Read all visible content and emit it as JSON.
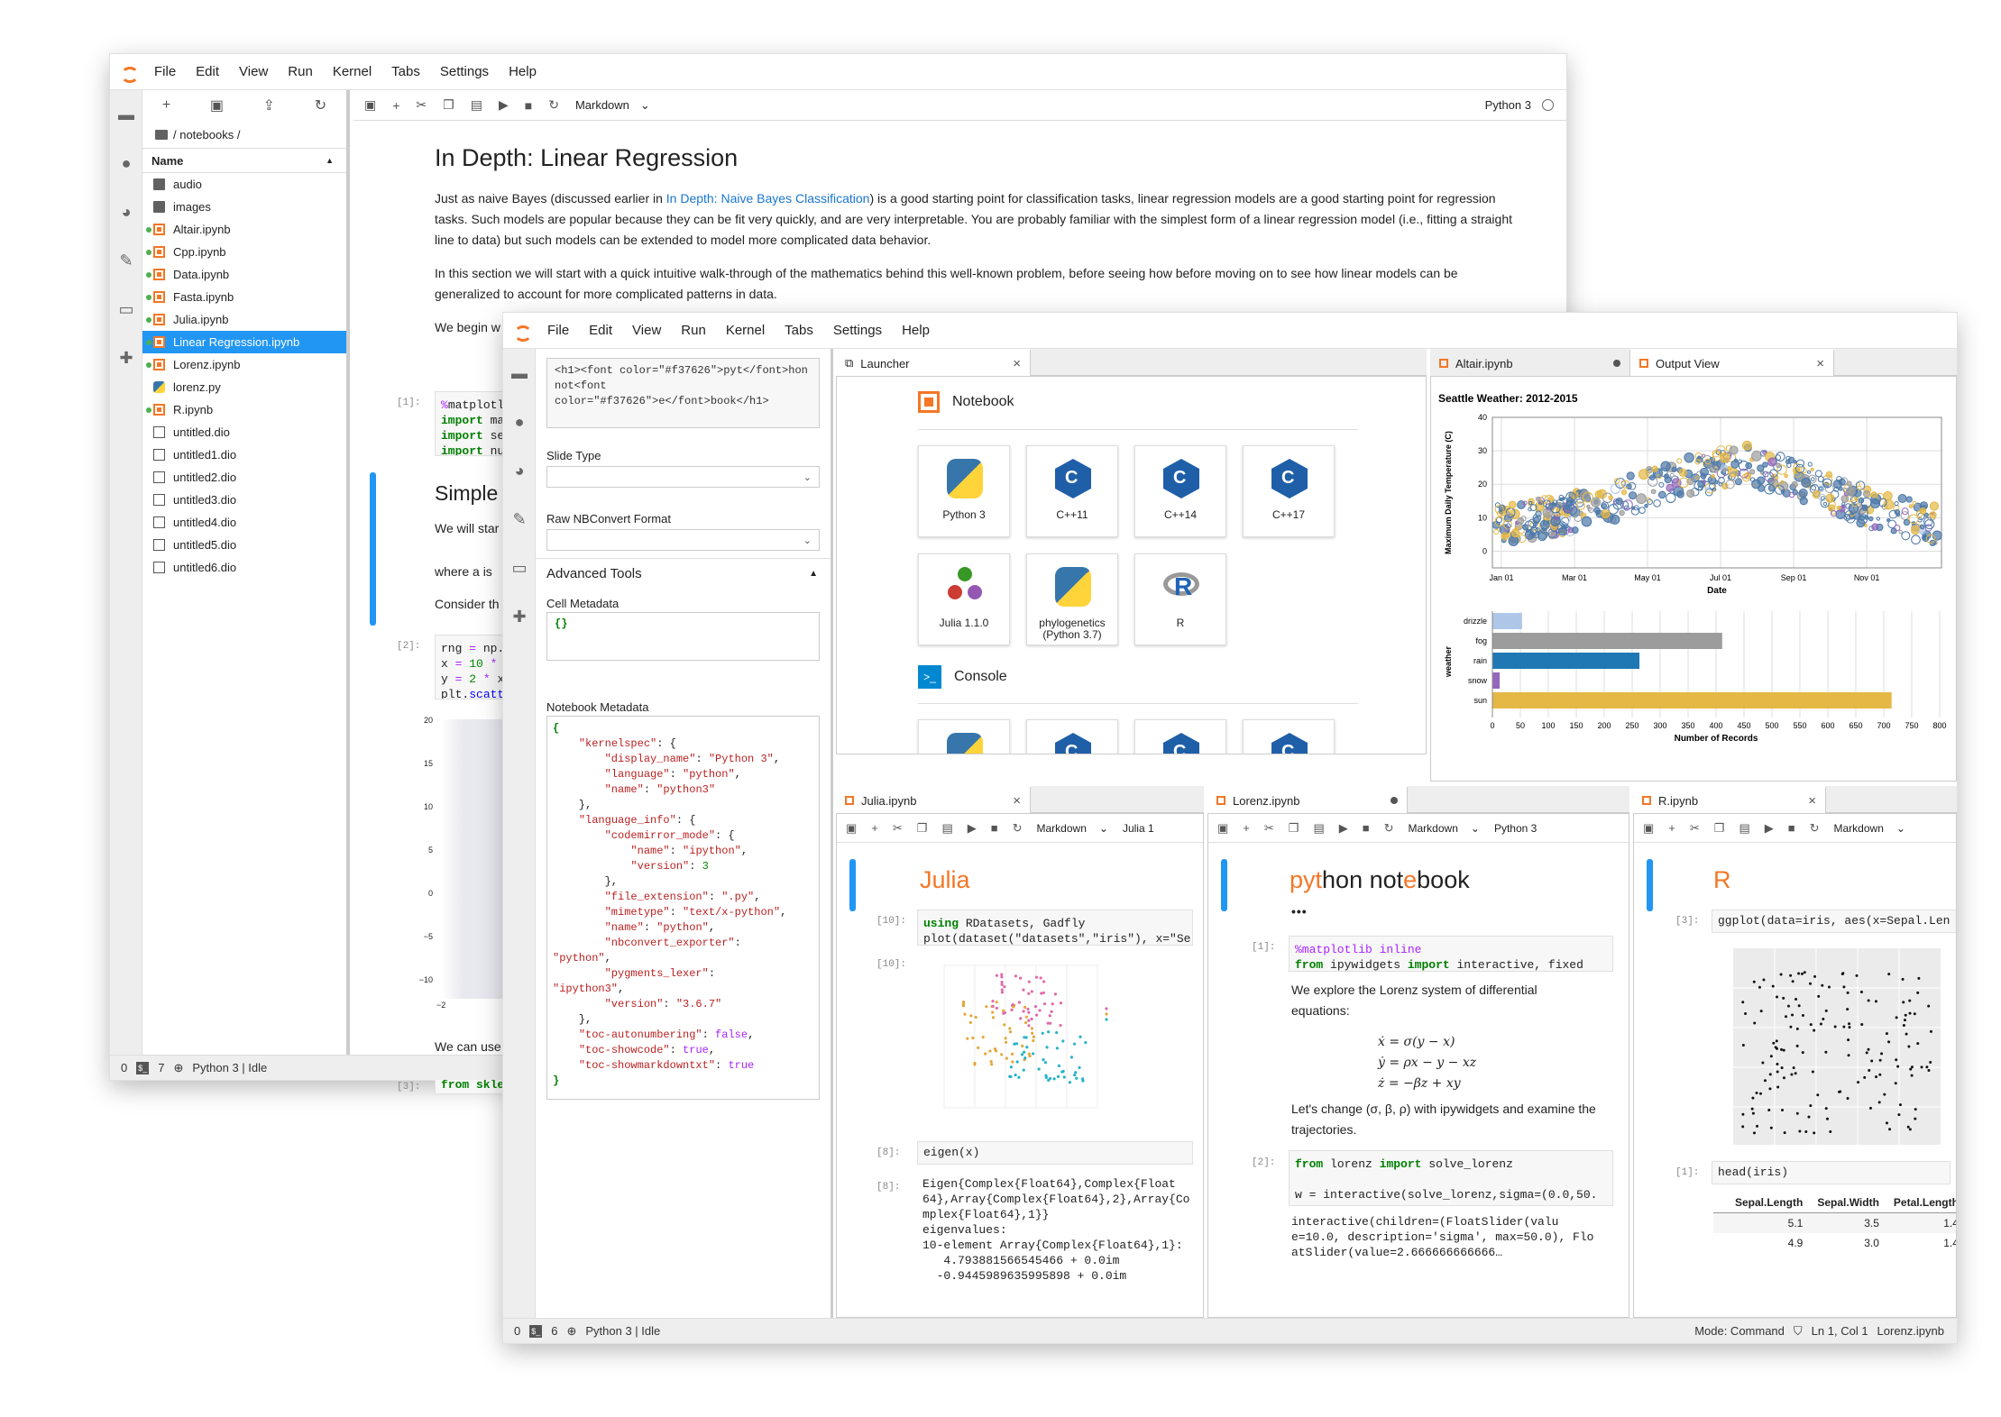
{
  "menu": [
    "File",
    "Edit",
    "View",
    "Run",
    "Kernel",
    "Tabs",
    "Settings",
    "Help"
  ],
  "win1": {
    "breadcrumb": "/ notebooks /",
    "name_header": "Name",
    "files": [
      {
        "name": "audio",
        "type": "folder",
        "running": false
      },
      {
        "name": "images",
        "type": "folder",
        "running": false
      },
      {
        "name": "Altair.ipynb",
        "type": "nb",
        "running": true
      },
      {
        "name": "Cpp.ipynb",
        "type": "nb",
        "running": true
      },
      {
        "name": "Data.ipynb",
        "type": "nb",
        "running": true
      },
      {
        "name": "Fasta.ipynb",
        "type": "nb",
        "running": true
      },
      {
        "name": "Julia.ipynb",
        "type": "nb",
        "running": true
      },
      {
        "name": "Linear Regression.ipynb",
        "type": "nb",
        "running": true,
        "selected": true
      },
      {
        "name": "Lorenz.ipynb",
        "type": "nb",
        "running": true
      },
      {
        "name": "lorenz.py",
        "type": "py",
        "running": false
      },
      {
        "name": "R.ipynb",
        "type": "nb",
        "running": true
      },
      {
        "name": "untitled.dio",
        "type": "file",
        "running": false
      },
      {
        "name": "untitled1.dio",
        "type": "file",
        "running": false
      },
      {
        "name": "untitled2.dio",
        "type": "file",
        "running": false
      },
      {
        "name": "untitled3.dio",
        "type": "file",
        "running": false
      },
      {
        "name": "untitled4.dio",
        "type": "file",
        "running": false
      },
      {
        "name": "untitled5.dio",
        "type": "file",
        "running": false
      },
      {
        "name": "untitled6.dio",
        "type": "file",
        "running": false
      }
    ],
    "cell_type": "Markdown",
    "kernel": "Python 3",
    "heading": "In Depth: Linear Regression",
    "p1_a": "Just as naive Bayes (discussed earlier in ",
    "p1_link": "In Depth: Naive Bayes Classification",
    "p1_b": ") is a good starting point for classification tasks, linear regression models are a good starting point for regression tasks. Such models are popular because they can be fit very quickly, and are very interpretable. You are probably familiar with the simplest form of a linear regression model (i.e., fitting a straight line to data) but such models can be extended to model more complicated data behavior.",
    "p2": "In this section we will start with a quick intuitive walk-through of the mathematics behind this well-known problem, before seeing how before moving on to see how linear models can be generalized to account for more complicated patterns in data.",
    "p3": "We begin w",
    "prompt1": "[1]:",
    "prompt2": "[2]:",
    "prompt3": "[3]:",
    "simple_heading": "Simple",
    "we_will": "We will star",
    "where": "where a is",
    "consider": "Consider th",
    "we_can": "We can use",
    "code3": "from skle",
    "yticks": [
      "20",
      "15",
      "10",
      "5",
      "0",
      "−5",
      "−10"
    ],
    "xtick": "−2",
    "status_num1": "0",
    "status_num2": "7",
    "status_kernel": "Python 3 | Idle"
  },
  "win2": {
    "html_snippet": "<h1><font color=\"#f37626\">pyt</font>hon not<font color=\"#f37626\">e</font>book</h1>",
    "slide_type_label": "Slide Type",
    "raw_nbconvert_label": "Raw NBConvert Format",
    "advanced_tools": "Advanced Tools",
    "cell_metadata_label": "Cell Metadata",
    "cell_metadata": "{}",
    "notebook_metadata_label": "Notebook Metadata",
    "launcher_tab": "Launcher",
    "notebook_section": "Notebook",
    "console_section": "Console",
    "kernels": [
      "Python 3",
      "C++11",
      "C++14",
      "C++17",
      "Julia 1.1.0",
      "phylogenetics (Python 3.7)",
      "R"
    ],
    "console_kernels": [
      "Python 3",
      "C++11",
      "C++14",
      "C++17"
    ],
    "altair_tab": "Altair.ipynb",
    "output_tab": "Output View",
    "julia_tab": "Julia.ipynb",
    "lorenz_tab": "Lorenz.ipynb",
    "r_tab": "R.ipynb",
    "julia_kernel": "Julia 1",
    "lorenz_kernel": "Python 3",
    "julia_title": "Julia",
    "python_title_parts": [
      "pyt",
      "hon not",
      "e",
      "book"
    ],
    "r_title": "R",
    "julia_prompt1": "[10]:",
    "julia_prompt2": "[10]:",
    "julia_prompt3": "[8]:",
    "julia_prompt4": "[8]:",
    "julia_code1a": "using",
    "julia_code1b": " RDatasets, Gadfly",
    "julia_code2": "plot(dataset(\"datasets\",\"iris\"), x=\"Se",
    "julia_code3": "eigen(x)",
    "julia_out": "Eigen{Complex{Float64},Complex{Float\n64},Array{Complex{Float64},2},Array{Co\nmplex{Float64},1}}\neigenvalues:\n10-element Array{Complex{Float64},1}:\n   4.793881566545466 + 0.0im\n  -0.9445989635995898 + 0.0im",
    "lorenz_prompt1": "[1]:",
    "lorenz_prompt2": "[2]:",
    "lorenz_code1a": "%matplotlib inline",
    "lorenz_code1b": "ipywidgets",
    "lorenz_code1c": "interactive, fixed",
    "lorenz_text1": "We explore the Lorenz system of differential equations:",
    "eq1": "ẋ = σ(y − x)",
    "eq2": "ẏ = ρx − y − xz",
    "eq3": "ż = −βz + xy",
    "lorenz_text2": "Let's change (σ, β, ρ) with ipywidgets and examine the trajectories.",
    "lorenz_code2a": "lorenz",
    "lorenz_code2b": "solve_lorenz",
    "lorenz_code2c": "w = interactive(solve_lorenz,sigma=(0.0,50.",
    "lorenz_code2d": "w",
    "lorenz_out": "interactive(children=(FloatSlider(valu\ne=10.0, description='sigma', max=50.0), Flo\natSlider(value=2.666666666666…",
    "ellipsis": "•••",
    "r_prompt1": "[3]:",
    "r_prompt2": "[1]:",
    "r_code1": "ggplot(data=iris, aes(x=Sepal.Len",
    "r_code2": "head(iris)",
    "r_table": {
      "columns": [
        "Sepal.Length",
        "Sepal.Width",
        "Petal.Length"
      ],
      "rows": [
        [
          "5.1",
          "3.5",
          "1.4"
        ],
        [
          "4.9",
          "3.0",
          "1.4"
        ]
      ]
    },
    "status_num1": "0",
    "status_num2": "6",
    "status_kernel": "Python 3 | Idle",
    "status_mode": "Mode: Command",
    "status_pos": "Ln 1, Col 1",
    "status_file": "Lorenz.ipynb"
  },
  "chart_data": [
    {
      "type": "scatter",
      "title": "Seattle Weather: 2012-2015",
      "xlabel": "Date",
      "ylabel": "Maximum Daily Temperature (C)",
      "x_ticks": [
        "Jan 01",
        "Mar 01",
        "May 01",
        "Jul 01",
        "Sep 01",
        "Nov 01"
      ],
      "y_ticks": [
        0,
        10,
        20,
        30,
        40
      ],
      "ylim": [
        -5,
        40
      ],
      "series_color": [
        "#4c78a8",
        "#e4b845",
        "#9c9c9c",
        "#9467bd",
        "#aec7e8"
      ],
      "trend": [
        {
          "x": 0,
          "y": 8
        },
        {
          "x": 1,
          "y": 11
        },
        {
          "x": 2,
          "y": 16
        },
        {
          "x": 3,
          "y": 22
        },
        {
          "x": 4,
          "y": 26
        },
        {
          "x": 5,
          "y": 20
        },
        {
          "x": 6,
          "y": 12
        },
        {
          "x": 7,
          "y": 8
        }
      ]
    },
    {
      "type": "bar",
      "orientation": "horizontal",
      "categories": [
        "drizzle",
        "fog",
        "rain",
        "snow",
        "sun"
      ],
      "values": [
        53,
        411,
        263,
        13,
        714
      ],
      "colors": [
        "#aec7e8",
        "#9c9c9c",
        "#1f77b4",
        "#9467bd",
        "#e4b845"
      ],
      "xlabel": "Number of Records",
      "ylabel": "weather",
      "x_ticks": [
        0,
        50,
        100,
        150,
        200,
        250,
        300,
        350,
        400,
        450,
        500,
        550,
        600,
        650,
        700,
        750,
        800
      ],
      "xlim": [
        0,
        800
      ]
    }
  ]
}
